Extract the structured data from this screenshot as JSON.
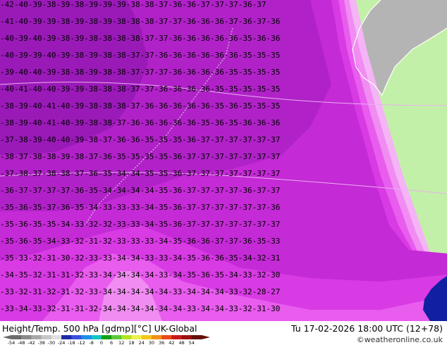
{
  "header": {
    "parameter": "Height/Temp. 500 hPa [gdmp][°C]",
    "model": "UK-Global",
    "valid_time": "Tu 17-02-2026 18:00 UTC (12+78)",
    "credit": "©weatheronline.co.uk"
  },
  "legend": {
    "labels": [
      "-54",
      "-48",
      "-42",
      "-38",
      "-30",
      "-24",
      "-18",
      "-12",
      "-8",
      "0",
      "6",
      "12",
      "18",
      "24",
      "30",
      "36",
      "42",
      "48",
      "54"
    ],
    "colors": [
      "#6b6b6b",
      "#8a8a8a",
      "#a8a8a8",
      "#c6c6c6",
      "#e0e0e0",
      "#1f2aa8",
      "#3a50e0",
      "#1e90e8",
      "#15c4c4",
      "#14a014",
      "#5cc83c",
      "#b4e41e",
      "#f0f050",
      "#f0c818",
      "#f09018",
      "#e84a18",
      "#c81818",
      "#9c1010",
      "#641008"
    ]
  },
  "map": {
    "land_color": "#c3f0a8",
    "sea_color": "#b4b4b4",
    "temp_colors": {
      "t_minus_40": "#9a1ab8",
      "t_minus_38": "#b022c8",
      "t_minus_36": "#c42ad6",
      "t_minus_34": "#d83ae4",
      "t_minus_32": "#e85cee",
      "t_minus_30": "#f08cf2",
      "t_minus_28": "#f4b4f6",
      "cold_core": "#1020a0"
    },
    "contour_labels": {
      "row_a": "-42-40-39-38-39-38-39-39-39-38-38-37-36-36-37-37-37-36-37",
      "row_b": "-41-40-39-39-38-39-38-39-38-38-38-37-37-36-36-36-37-36-37-36",
      "row_c": "-40-39-40-39-38-39-38-38-38-38-37-37-36-36-36-36-36-35-36-36",
      "row_d": "-40-39-39-40-39-38-39-38-38-37-37-36-36-36-36-36-36-35-35-35",
      "row_e": "-39-40-40-39-38-38-39-38-38-37-37-37-36-36-36-36-35-35-35-35",
      "row_f": "-40-41-40-40-39-39-38-38-38-37-37-36-36-36-36-35-35-35-35-35",
      "row_g": "-38-39-40-41-40-39-38-38-38-37-36-36-36-36-36-35-36-35-35-35",
      "row_h": "-38-39-40-41-40-39-38-38-37-36-36-36-36-36-35-36-35-36-36-36",
      "row_i": "-37-38-39-40-40-39-38-37-36-36-35-35-35-36-37-37-37-37-37-37",
      "row_j": "-38-37-38-38-39-38-37-36-35-35-35-35-36-37-37-37-37-37-37-37",
      "row_k": "-37-38-37-38-38-37-36-35-34-34-35-35-36-37-37-37-37-37-37-37",
      "row_l": "-36-37-37-37-37-36-35-34-34-34-34-35-36-37-37-37-37-36-37-37",
      "row_m": "-35-36-35-37-36-35-34-33-33-33-34-35-36-37-37-37-37-37-37-36",
      "row_n": "-35-36-35-35-34-33-32-32-33-33-34-35-36-37-37-37-37-37-37-37",
      "row_o": "-35-36-35-34-33-32-31-32-33-33-33-34-35-36-36-37-37-36-35-33",
      "row_p": "-35-33-32-31-30-32-33-33-34-34-33-33-34-35-36-36-35-34-32-31",
      "row_q": "-34-35-32-31-31-32-33-34-34-34-34-33-34-35-36-35-34-33-32-30",
      "row_r": "-33-32-31-32-31-32-33-34-34-34-34-34-33-34-34-34-33-32-28-27",
      "row_s": "-33-34-33-32-31-31-32-34-34-34-34-34-34-33-34-34-33-32-31-30"
    }
  }
}
